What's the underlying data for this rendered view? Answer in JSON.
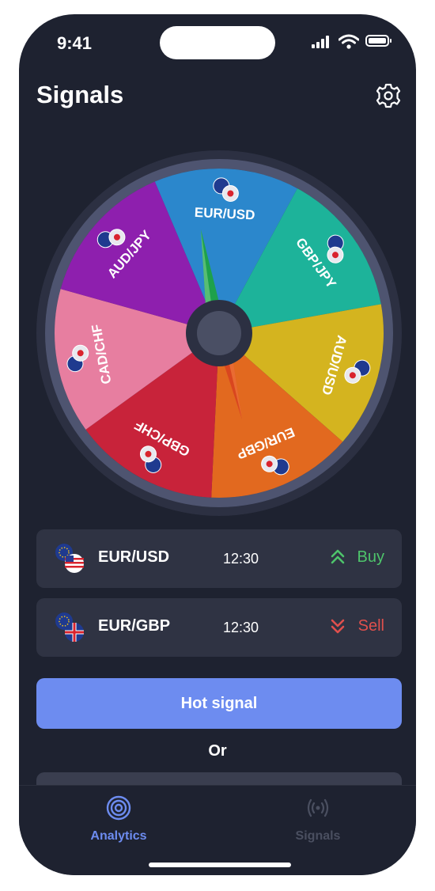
{
  "status_bar": {
    "time": "9:41"
  },
  "header": {
    "title": "Signals"
  },
  "wheel": {
    "segments": [
      {
        "label": "EUR/USD",
        "color": "#2b87cc"
      },
      {
        "label": "GBP/JPY",
        "color": "#1db39a"
      },
      {
        "label": "AUD/USD",
        "color": "#d4b41f"
      },
      {
        "label": "EUR/GBP",
        "color": "#e2691f"
      },
      {
        "label": "GBP/CHF",
        "color": "#c8233a"
      },
      {
        "label": "CAD/CHF",
        "color": "#e77ea0"
      },
      {
        "label": "AUD/JPY",
        "color": "#8e1fae"
      }
    ]
  },
  "signals": [
    {
      "pair": "EUR/USD",
      "time": "12:30",
      "action": "Buy",
      "action_color": "#4ec46b",
      "icon": "double-chevron-up-icon"
    },
    {
      "pair": "EUR/GBP",
      "time": "12:30",
      "action": "Sell",
      "action_color": "#e0504d",
      "icon": "double-chevron-down-icon"
    }
  ],
  "actions": {
    "hot_signal": "Hot signal",
    "or": "Or"
  },
  "tabbar": {
    "tabs": [
      {
        "label": "Analytics",
        "icon": "target-icon",
        "active": true
      },
      {
        "label": "Signals",
        "icon": "broadcast-icon",
        "active": false
      }
    ],
    "active_color": "#6d8cf0",
    "inactive_color": "#4a4f60"
  }
}
